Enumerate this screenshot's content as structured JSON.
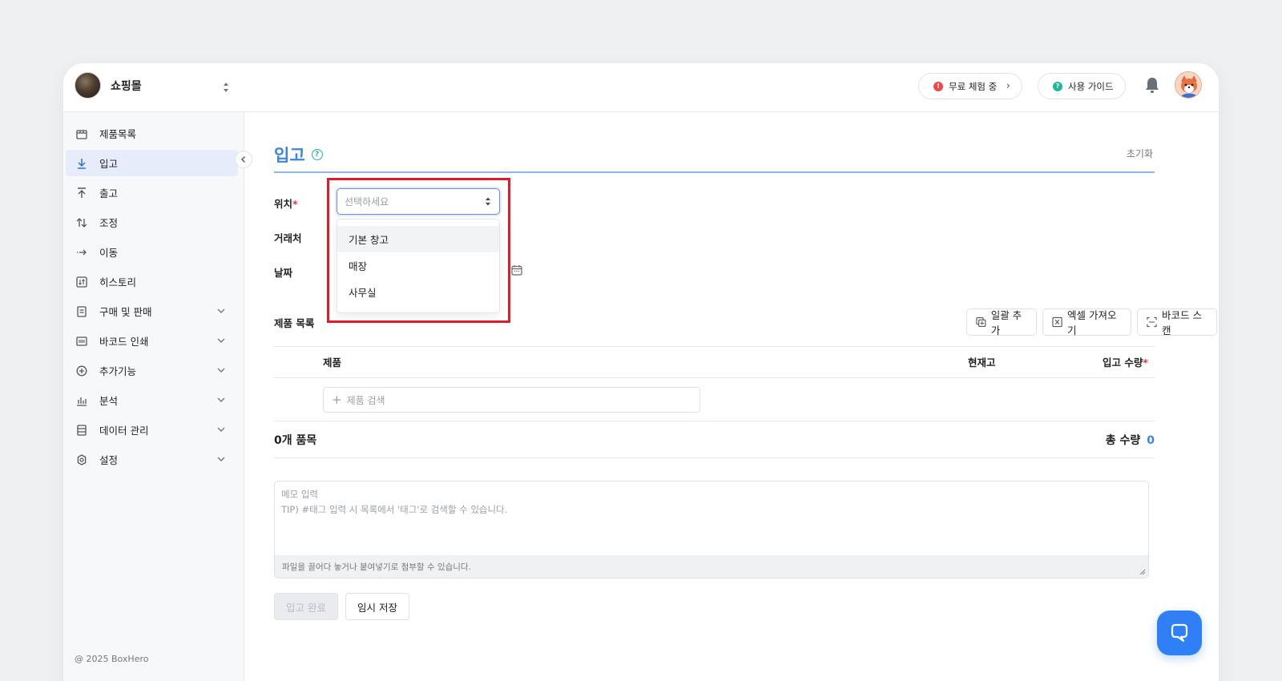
{
  "header": {
    "store_name": "쇼핑몰",
    "trial_label": "무료 체험 중",
    "guide_label": "사용 가이드"
  },
  "sidebar": {
    "items": [
      {
        "label": "제품목록"
      },
      {
        "label": "입고"
      },
      {
        "label": "출고"
      },
      {
        "label": "조정"
      },
      {
        "label": "이동"
      },
      {
        "label": "히스토리"
      },
      {
        "label": "구매 및 판매"
      },
      {
        "label": "바코드 인쇄"
      },
      {
        "label": "추가기능"
      },
      {
        "label": "분석"
      },
      {
        "label": "데이터 관리"
      },
      {
        "label": "설정"
      }
    ],
    "footer": "@ 2025 BoxHero"
  },
  "page": {
    "title": "입고",
    "reset_label": "초기화"
  },
  "form": {
    "location_label": "위치",
    "required_mark": "*",
    "location_placeholder": "선택하세요",
    "location_options": [
      "기본 창고",
      "매장",
      "사무실"
    ],
    "partner_label": "거래처",
    "date_label": "날짜"
  },
  "products": {
    "section_label": "제품 목록",
    "bulk_add_label": "일괄 추가",
    "excel_import_label": "엑셀 가져오기",
    "barcode_scan_label": "바코드 스캔",
    "col_product": "제품",
    "col_stock": "현재고",
    "col_qty": "입고 수량",
    "search_placeholder": "제품 검색"
  },
  "summary": {
    "item_count": "0개 품목",
    "total_label": "총 수량",
    "total_value": "0"
  },
  "memo": {
    "line1": "메모 입력",
    "line2": "TIP) #태그 입력 시 목록에서 '태그'로 검색할 수 있습니다.",
    "attach_hint": "파일을 끌어다 놓거나 붙여넣기로 첨부할 수 있습니다."
  },
  "actions": {
    "complete_label": "입고 완료",
    "draft_label": "임시 저장"
  },
  "colors": {
    "accent": "#3b87e0",
    "highlight_border": "#e01b2a",
    "chat_fab": "#2f7ff6"
  }
}
